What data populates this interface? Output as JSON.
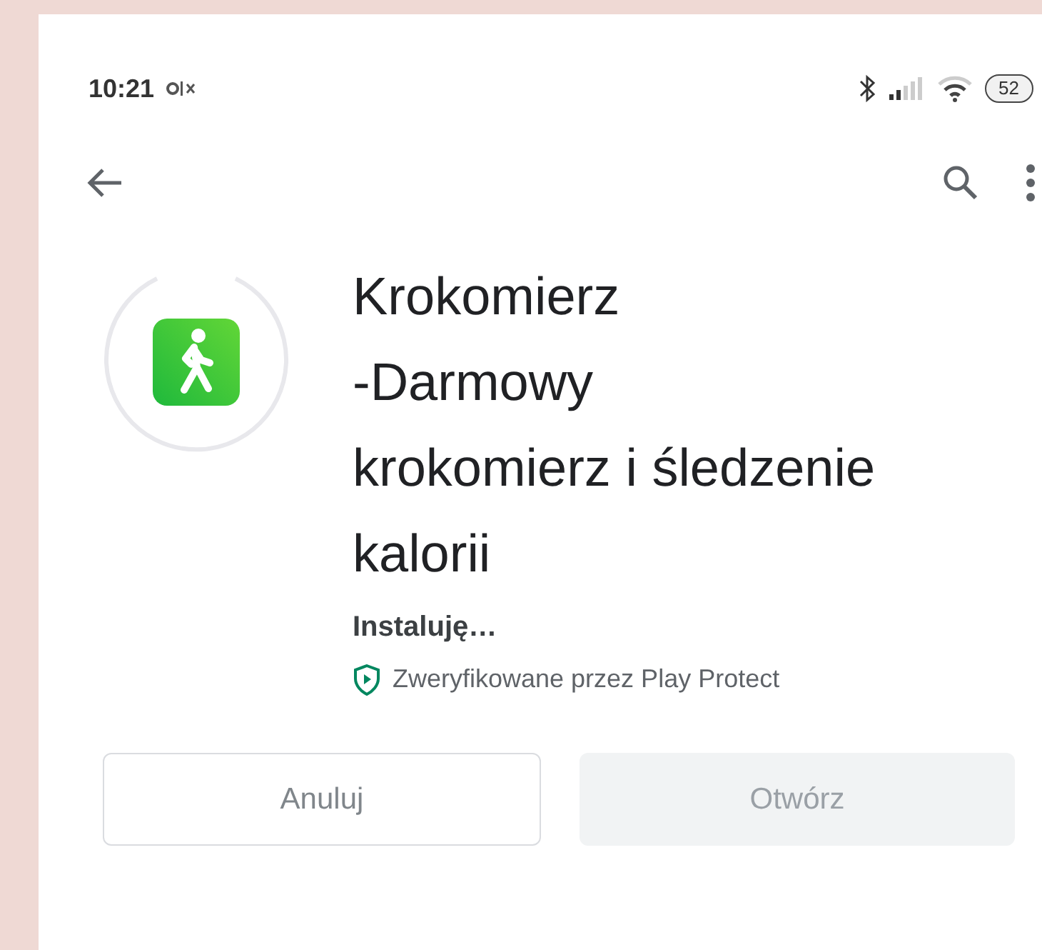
{
  "status_bar": {
    "time": "10:21",
    "battery": "52"
  },
  "app": {
    "title_lines": [
      "Krokomierz",
      "-Darmowy",
      "krokomierz i śledzenie",
      "kalorii"
    ],
    "status": "Instaluję…",
    "verified": "Zweryfikowane przez Play Protect"
  },
  "buttons": [
    {
      "label": "Anuluj",
      "kind": "outline",
      "disabled": false
    },
    {
      "label": "Otwórz",
      "kind": "filled",
      "disabled": true
    }
  ]
}
